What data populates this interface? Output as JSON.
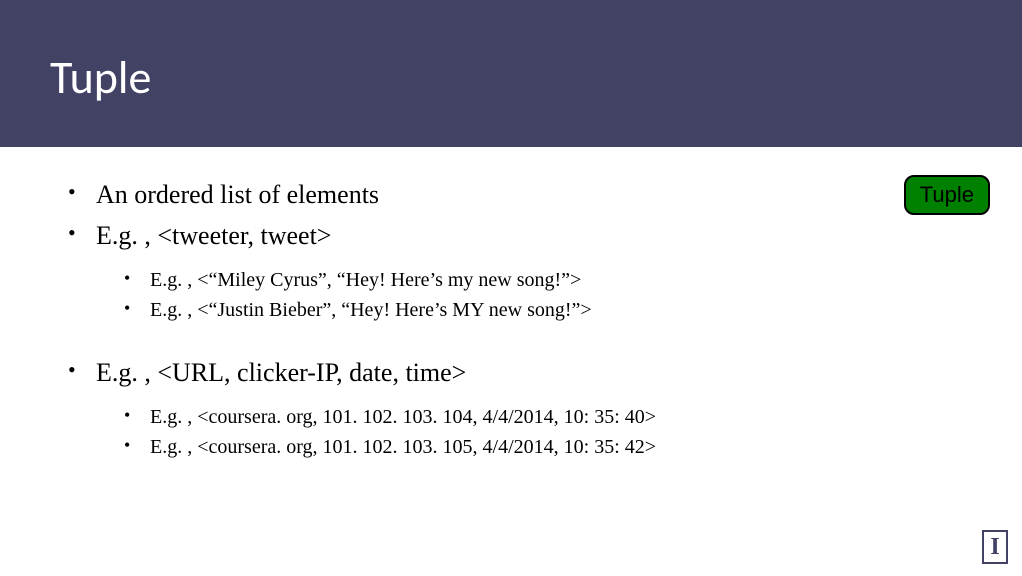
{
  "header": {
    "title": "Tuple"
  },
  "tag": {
    "label": "Tuple"
  },
  "bullets": {
    "item0": "An ordered list of elements",
    "item1": "E.g. , <tweeter, tweet>",
    "item1_sub0": "E.g. , <“Miley Cyrus”, “Hey! Here’s my new song!”>",
    "item1_sub1": "E.g. , <“Justin Bieber”, “Hey! Here’s MY new song!”>",
    "item2": "E.g. , <URL, clicker-IP, date, time>",
    "item2_sub0": "E.g. , <coursera. org, 101. 102. 103. 104, 4/4/2014, 10: 35: 40>",
    "item2_sub1": "E.g. , <coursera. org, 101. 102. 103. 105, 4/4/2014, 10: 35: 42>"
  },
  "logo": {
    "letter": "I"
  }
}
